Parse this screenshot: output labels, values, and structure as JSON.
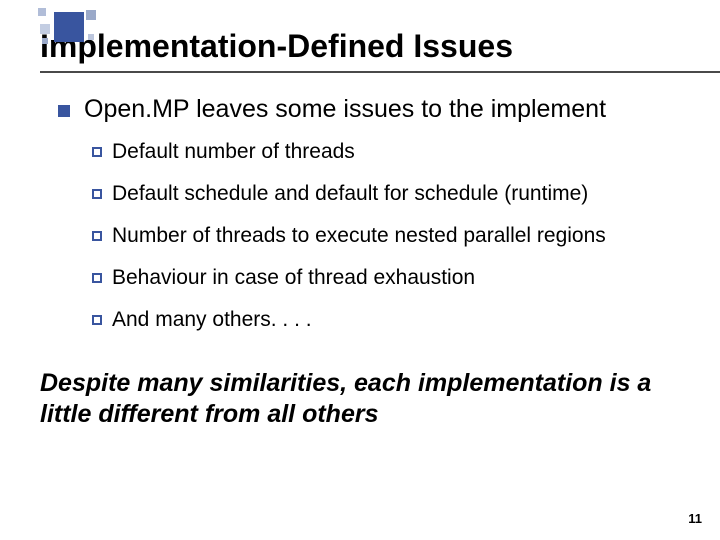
{
  "title": "Implementation-Defined Issues",
  "main_point": "Open.MP leaves some issues to the implement",
  "sub_points": [
    "Default number of threads",
    "Default schedule and default for schedule (runtime)",
    "Number of threads to execute nested parallel regions",
    "Behaviour in case of thread exhaustion",
    "And many others. . . ."
  ],
  "closing": "Despite many similarities, each implementation is a little different from all others",
  "page_number": "11"
}
